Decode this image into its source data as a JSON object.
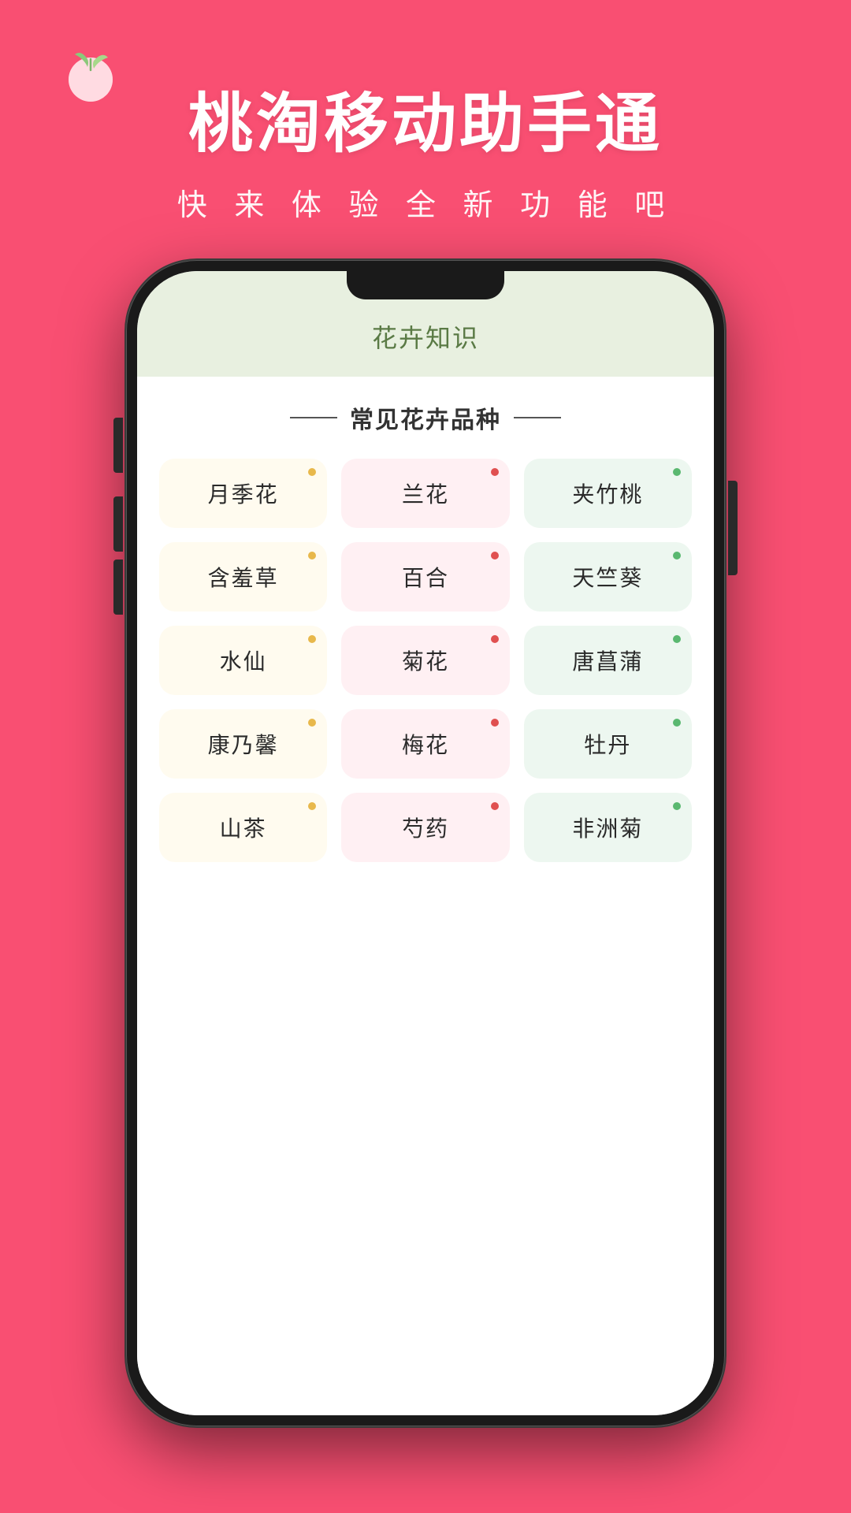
{
  "background_color": "#f94f72",
  "header": {
    "title": "桃淘移动助手通",
    "subtitle": "快 来 体 验 全 新 功 能 吧"
  },
  "screen": {
    "header_title": "花卉知识",
    "section_title": "常见花卉品种",
    "flowers": [
      {
        "name": "月季花",
        "color": "yellow",
        "dot": "yellow"
      },
      {
        "name": "兰花",
        "color": "pink",
        "dot": "red"
      },
      {
        "name": "夹竹桃",
        "color": "green",
        "dot": "green"
      },
      {
        "name": "含羞草",
        "color": "yellow",
        "dot": "yellow"
      },
      {
        "name": "百合",
        "color": "pink",
        "dot": "red"
      },
      {
        "name": "天竺葵",
        "color": "green",
        "dot": "green"
      },
      {
        "name": "水仙",
        "color": "yellow",
        "dot": "yellow"
      },
      {
        "name": "菊花",
        "color": "pink",
        "dot": "red"
      },
      {
        "name": "唐菖蒲",
        "color": "green",
        "dot": "green"
      },
      {
        "name": "康乃馨",
        "color": "yellow",
        "dot": "yellow"
      },
      {
        "name": "梅花",
        "color": "pink",
        "dot": "red"
      },
      {
        "name": "牡丹",
        "color": "green",
        "dot": "green"
      },
      {
        "name": "山茶",
        "color": "yellow",
        "dot": "yellow"
      },
      {
        "name": "芍药",
        "color": "pink",
        "dot": "red"
      },
      {
        "name": "非洲菊",
        "color": "green",
        "dot": "green"
      }
    ]
  }
}
